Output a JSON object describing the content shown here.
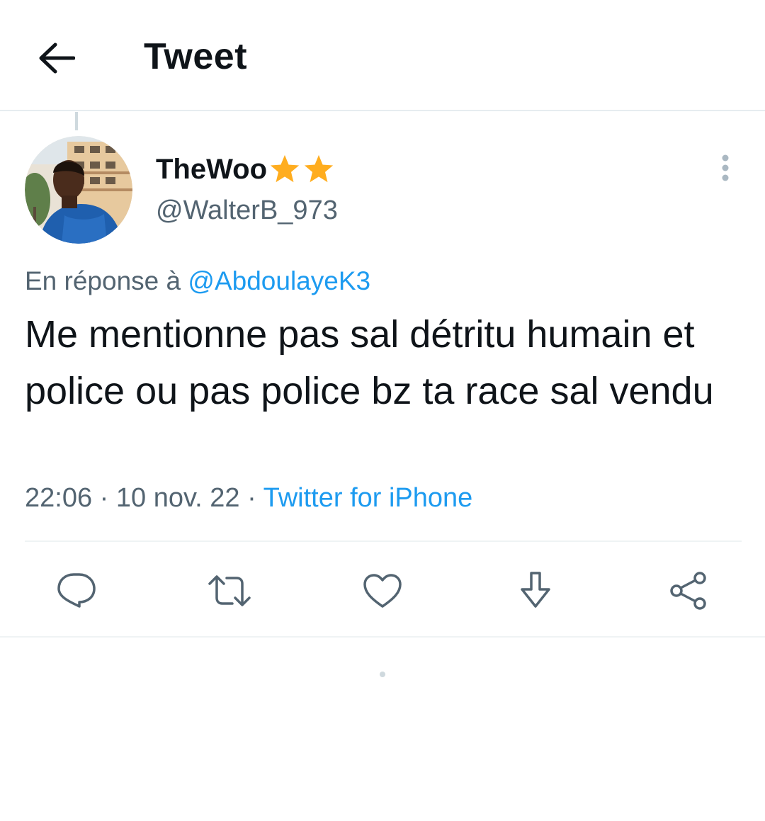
{
  "header": {
    "title": "Tweet",
    "back_icon": "arrow-left-icon"
  },
  "tweet": {
    "author": {
      "display_name": "TheWoo",
      "badges": [
        "star-icon",
        "star-icon"
      ],
      "handle": "@WalterB_973"
    },
    "reply_prefix": "En réponse à",
    "reply_to": "@AbdoulayeK3",
    "text": "Me mentionne pas sal détritu humain et police ou pas police bz ta race sal vendu",
    "time": "22:06",
    "date": "10 nov. 22",
    "separator": "·",
    "source": "Twitter for iPhone"
  },
  "actions": [
    "reply-icon",
    "retweet-icon",
    "like-icon",
    "download-icon",
    "share-icon"
  ],
  "colors": {
    "text": "#0f1419",
    "secondary": "#536471",
    "link": "#1d9bf0",
    "star": "#ffad1f",
    "divider": "#eff3f4"
  }
}
